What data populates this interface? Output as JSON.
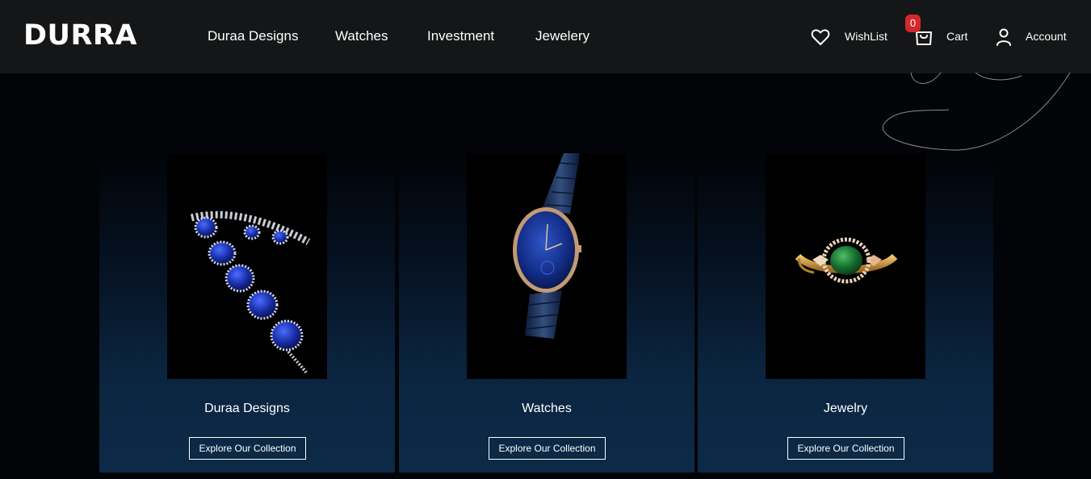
{
  "brand": {
    "logo": "DURRA"
  },
  "nav": {
    "items": [
      {
        "label": "Duraa Designs"
      },
      {
        "label": "Watches"
      },
      {
        "label": "Investment"
      },
      {
        "label": "Jewelery"
      }
    ]
  },
  "header_actions": {
    "wishlist_label": "WishList",
    "wishlist_icon": "heart-icon",
    "cart_label": "Cart",
    "cart_icon": "shopping-bag-icon",
    "cart_count": "0",
    "account_label": "Account",
    "account_icon": "user-icon"
  },
  "cards": [
    {
      "title": "Duraa Designs",
      "button": "Explore Our Collection",
      "image": "sapphire-bracelet-image"
    },
    {
      "title": "Watches",
      "button": "Explore Our Collection",
      "image": "blue-watch-image"
    },
    {
      "title": "Jewelry",
      "button": "Explore Our Collection",
      "image": "emerald-ring-image"
    }
  ],
  "colors": {
    "header_bg": "#141617",
    "page_bg": "#020407",
    "card_gradient_end": "#0c2a47",
    "badge": "#d4282d"
  }
}
